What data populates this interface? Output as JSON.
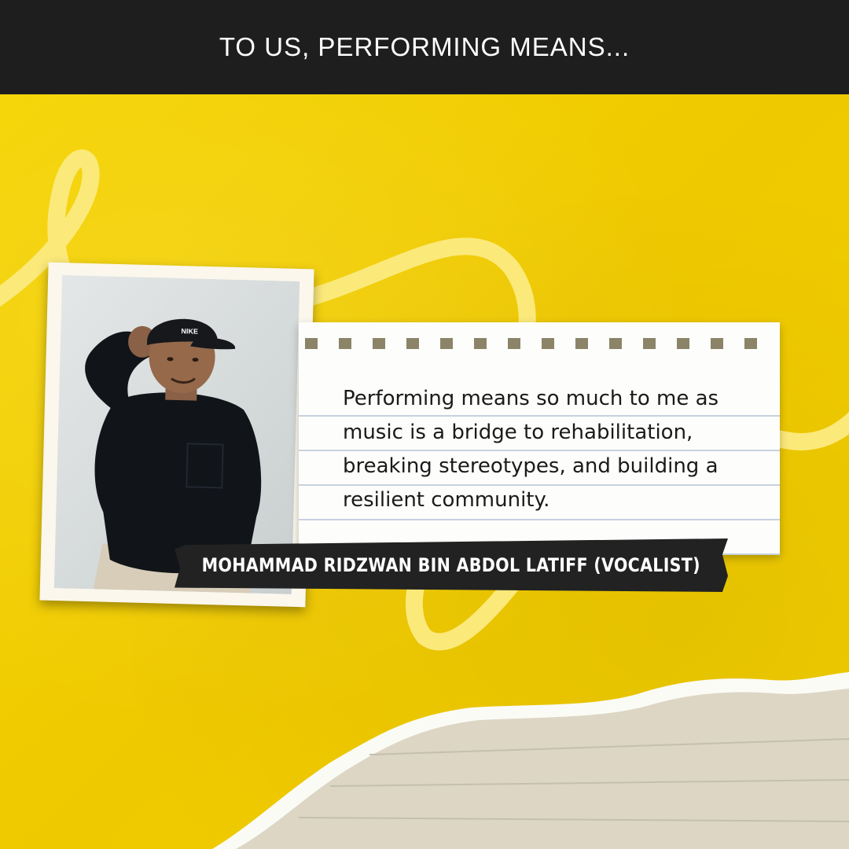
{
  "header": {
    "title": "TO US, PERFORMING MEANS..."
  },
  "quote": {
    "text": "Performing means so much to me as music is a bridge to rehabilitation, breaking stereotypes, and building a resilient community."
  },
  "performer": {
    "name_label": "MOHAMMAD RIDZWAN BIN ABDOL LATIFF (VOCALIST)",
    "cap_logo": "NIKE"
  },
  "colors": {
    "background_yellow": "#f2cf00",
    "header_bar": "#1e1e1e",
    "swirl": "#fbe97a",
    "tape": "#222222",
    "torn_paper": "#ddd6c4"
  },
  "icons": {
    "decoration": "swirl-flourish",
    "photo": "performer-portrait"
  }
}
